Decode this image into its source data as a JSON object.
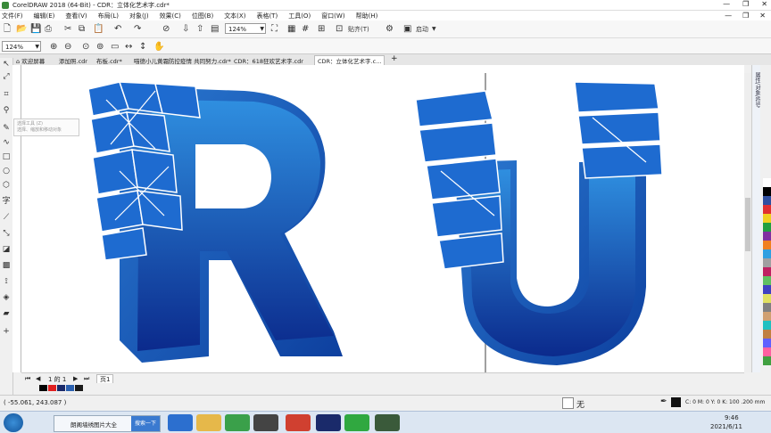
{
  "window": {
    "title": "CorelDRAW 2018 (64-Bit) - CDR：立体化艺术字.cdr*"
  },
  "menu": [
    "文件(F)",
    "编辑(E)",
    "查看(V)",
    "布局(L)",
    "对象(J)",
    "效果(C)",
    "位图(B)",
    "文本(X)",
    "表格(T)",
    "工具(O)",
    "窗口(W)",
    "帮助(H)"
  ],
  "toolbar": {
    "zoom": "124%",
    "snap": "贴齐(T)",
    "launch": "启动"
  },
  "propbar": {
    "zoom": "124%"
  },
  "tabs": [
    "欢迎屏幕",
    "添加照.cdr",
    "布板.cdr*",
    "喵德小儿黄霜防控疫情 共同努力.cdr*",
    "CDR：618狂欢艺术字.cdr",
    "CDR：立体化艺术字.c..."
  ],
  "active_tab": 5,
  "tooltip": {
    "title": "选择工具 (Z)",
    "desc": "选择、缩放和移动对象"
  },
  "canvas": {
    "letter_r": "R",
    "letter_u": "U"
  },
  "pagenav": {
    "page": "1 的 1",
    "page_tab": "页1"
  },
  "colors": {
    "letter_light": "#2f8fe0",
    "letter_dark": "#0b2a8c",
    "letter_side": "#0d3f9e"
  },
  "color_strip": [
    "#000000",
    "#e02020",
    "#1a2a6a",
    "#2a60b0",
    "#1a1a1a"
  ],
  "palette": [
    "#ffffff",
    "#000000",
    "#3050a0",
    "#e03030",
    "#f0d020",
    "#20a040",
    "#8030a0",
    "#f08020",
    "#30a0e0",
    "#a0a0a0",
    "#c02060",
    "#60c060",
    "#4040c0",
    "#e0e060",
    "#808080",
    "#d0a070",
    "#20c0c0",
    "#c08040",
    "#6060ff",
    "#ff60a0",
    "#40a040"
  ],
  "status": {
    "coords": "( -55.061, 243.087 )",
    "fill_none": "无",
    "fill_info": "C: 0 M: 0 Y: 0 K: 100  .200 mm"
  },
  "taskbar": {
    "start": "",
    "app1": "朗阁墙绣图片大全",
    "search": "搜索一下",
    "time": "9:46",
    "date": "2021/6/11"
  }
}
